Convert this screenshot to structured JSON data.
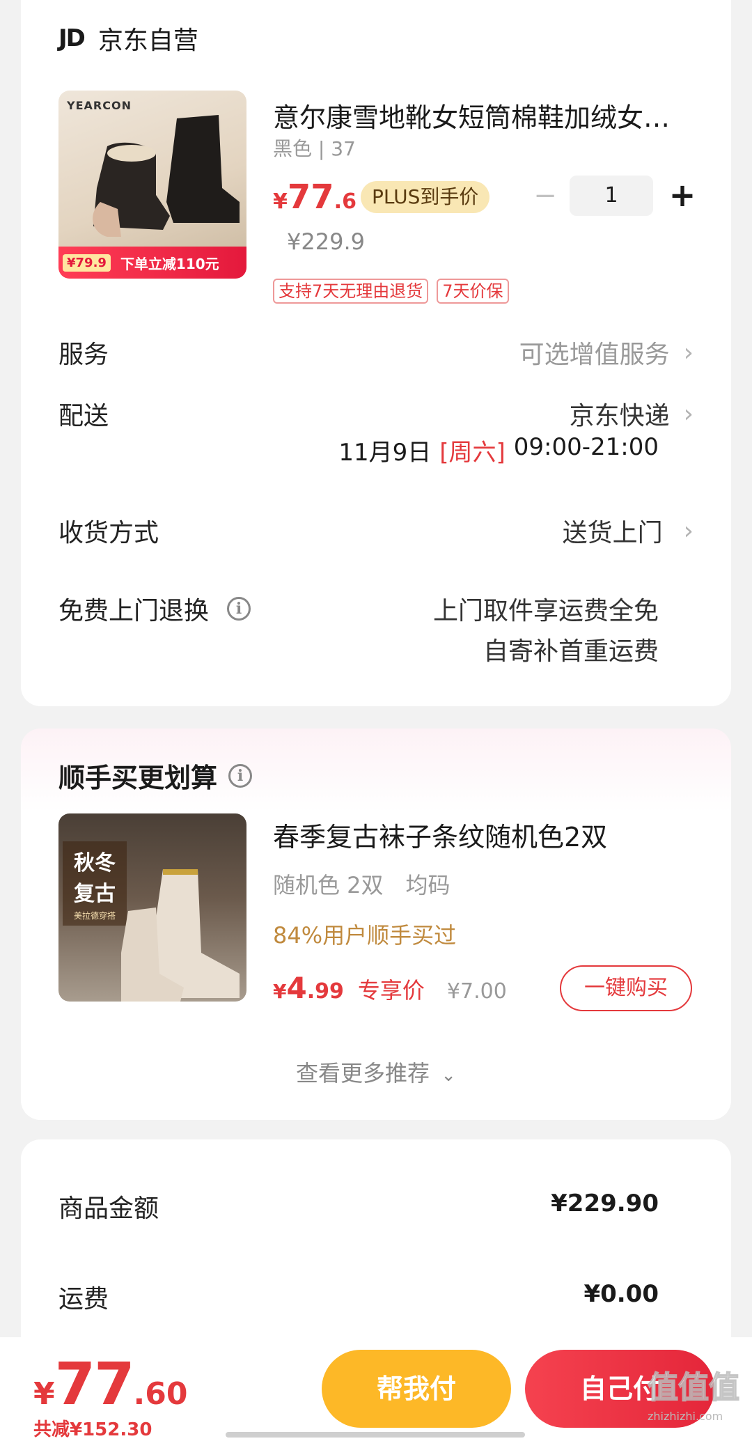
{
  "store": {
    "logo": "JD",
    "name": "京东自营"
  },
  "product": {
    "image_brand": "YEARCON",
    "image_promo_big": "下单立减110元",
    "image_promo_price": "¥79.9",
    "title": "意尔康雪地靴女短筒棉鞋加绒女…",
    "variant": "黑色 | 37",
    "price_symbol": "¥",
    "price_int": "77",
    "price_dec": ".6",
    "plus_label": "PLUS到手价",
    "original_price": "¥229.9",
    "quantity": "1",
    "minus": "−",
    "plus": "+",
    "tags": [
      "支持7天无理由退货",
      "7天价保"
    ]
  },
  "service": {
    "label": "服务",
    "value": "可选增值服务"
  },
  "delivery": {
    "label": "配送",
    "value": "京东快递",
    "date": "11月9日",
    "weekday": "[周六]",
    "time": "09:00-21:00"
  },
  "receive": {
    "label": "收货方式",
    "value": "送货上门"
  },
  "free_return": {
    "label": "免费上门退换",
    "line1": "上门取件享运费全免",
    "line2": "自寄补首重运费"
  },
  "addon": {
    "heading": "顺手买更划算",
    "image_text1": "秋冬",
    "image_text2": "复古",
    "image_text3": "美拉德穿搭",
    "title": "春季复古袜子条纹随机色2双",
    "spec1": "随机色 2双",
    "spec2": "均码",
    "popularity": "84%用户顺手买过",
    "price_symbol": "¥",
    "price_int": "4",
    "price_dec": ".99",
    "exclusive_label": "专享价",
    "original_price": "¥7.00",
    "buy_button": "一键购买",
    "more": "查看更多推荐"
  },
  "summary": {
    "goods_label": "商品金额",
    "goods_value": "¥229.90",
    "shipping_label": "运费",
    "shipping_value": "¥0.00"
  },
  "bottom_bar": {
    "total_symbol": "¥",
    "total_int": "77",
    "total_dec": ".60",
    "saved": "共减¥152.30",
    "help_pay": "帮我付",
    "self_pay": "自己付",
    "watermark": "值",
    "watermark_url": "zhizhizhi.com"
  },
  "colors": {
    "accent": "#e4393c",
    "plus_gold": "#f9e7b4",
    "help_pay": "#fdb827",
    "addon_gold": "#c08a3e"
  }
}
